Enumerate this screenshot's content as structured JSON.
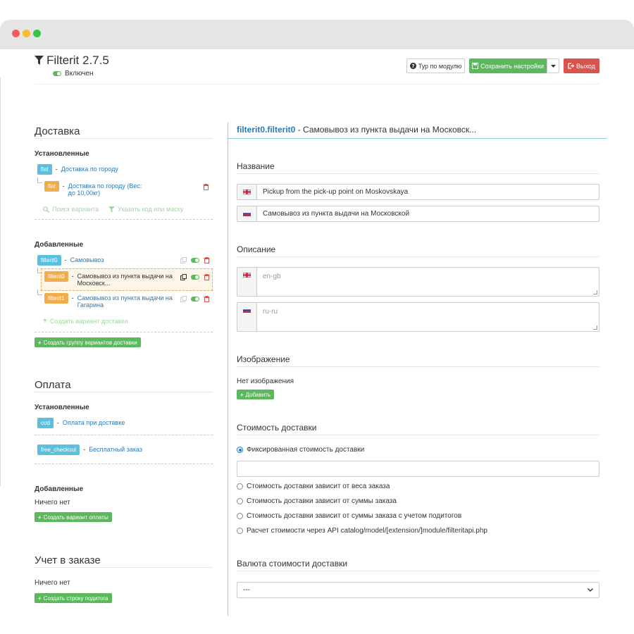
{
  "app": {
    "title": "Filterit 2.7.5",
    "status": "Включен",
    "tour_label": "Тур по модулю",
    "save_label": "Сохранить настройки",
    "exit_label": "Выход",
    "colors": {
      "green": "#5cb85c",
      "red": "#d9534f",
      "info": "#5bc0de",
      "warning": "#f0ad4e",
      "link": "#2a7ab8"
    }
  },
  "delivery": {
    "heading": "Доставка",
    "installed_label": "Установленные",
    "installed": [
      {
        "code": "flat",
        "name": "Доставка по городу"
      },
      {
        "code": "flat",
        "name": "Доставка по городу (Вес: до 10,00кг)"
      }
    ],
    "search_label": "Поиск варианта",
    "filter_label": "Указать код или маску",
    "added_label": "Добавленные",
    "added": [
      {
        "code": "filterit0",
        "name": "Самовывоз"
      },
      {
        "code": "filterit0",
        "name": "Самовывоз из пункта выдачи на Московск..."
      },
      {
        "code": "filterit1",
        "name": "Самовывоз из пункта выдачи на Гагарина"
      }
    ],
    "create_variant_label": "Создать вариант доставки",
    "create_group_label": "Создать группу вариантов доставки"
  },
  "payment": {
    "heading": "Оплата",
    "installed_label": "Установленные",
    "installed": [
      {
        "code": "cod",
        "name": "Оплата при доставке"
      },
      {
        "code": "free_checkout",
        "name": "Бесплатный заказ"
      }
    ],
    "added_label": "Добавленные",
    "added_empty": "Ничего нет",
    "create_label": "Создать вариант оплаты"
  },
  "totals": {
    "heading": "Учет в заказе",
    "empty": "Ничего нет",
    "create_label": "Создать строку подитога"
  },
  "editor": {
    "code": "filterit0.filterit0",
    "title_sep": " - ",
    "title": "Самовывоз из пункта выдачи на Московск...",
    "name_heading": "Название",
    "name_en": "Pickup from the pick-up point on Moskovskaya",
    "name_ru": "Самовывоз из пункта выдачи на Московской",
    "desc_heading": "Описание",
    "desc_en_placeholder": "en-gb",
    "desc_ru_placeholder": "ru-ru",
    "image_heading": "Изображение",
    "no_image": "Нет изображения",
    "add_label": "Добавить",
    "cost_heading": "Стоимость доставки",
    "cost_options": [
      "Фиксированная стоимость доставки",
      "Стоимость доставки зависит от веса заказа",
      "Стоимость доставки зависит от суммы заказа",
      "Стоимость доставки зависит от суммы заказа с учетом подитогов",
      "Расчет стоимости через API catalog/model/[extension/]module/filteritapi.php"
    ],
    "cost_selected": 0,
    "currency_heading": "Валюта стоимости доставки",
    "currency_value": "---"
  }
}
